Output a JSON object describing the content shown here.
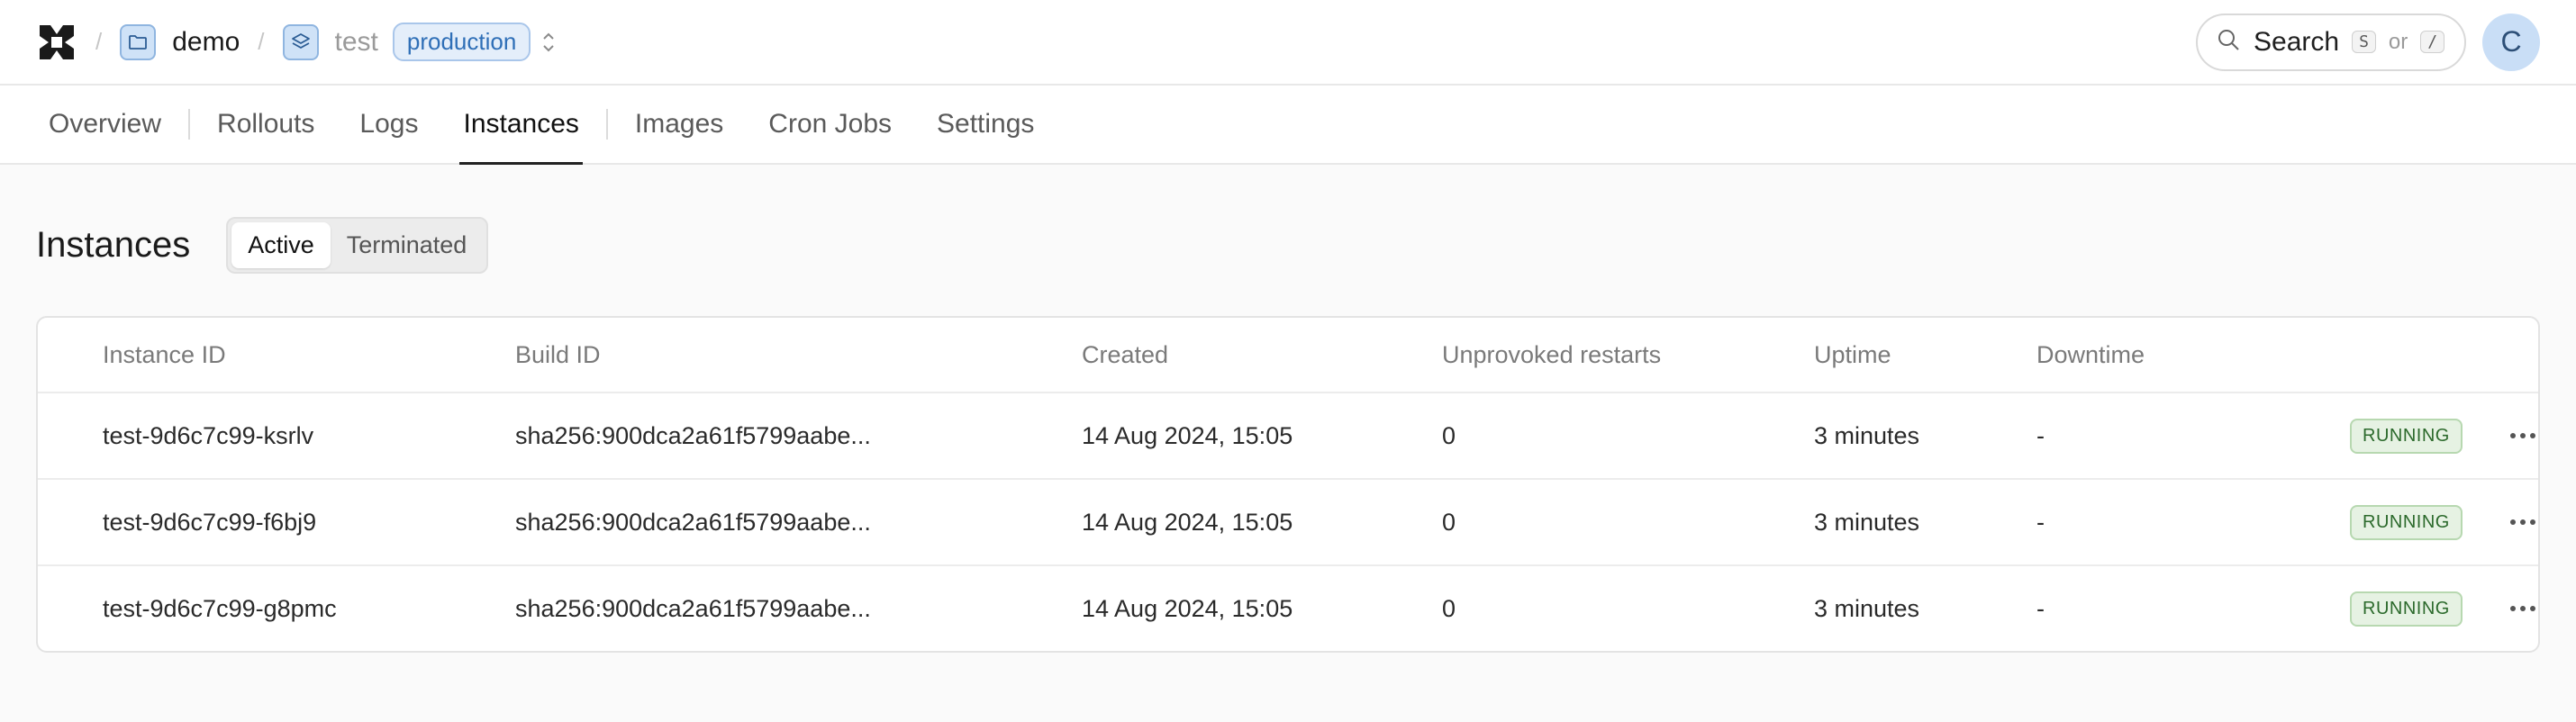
{
  "breadcrumb": {
    "project": "demo",
    "service": "test",
    "environment": "production"
  },
  "search": {
    "label": "Search",
    "shortcut_1": "S",
    "or_label": "or",
    "shortcut_2": "/"
  },
  "user": {
    "initial": "C"
  },
  "tabs": [
    {
      "label": "Overview"
    },
    {
      "label": "Rollouts"
    },
    {
      "label": "Logs"
    },
    {
      "label": "Instances"
    },
    {
      "label": "Images"
    },
    {
      "label": "Cron Jobs"
    },
    {
      "label": "Settings"
    }
  ],
  "page": {
    "title": "Instances",
    "filter_active": "Active",
    "filter_terminated": "Terminated"
  },
  "table": {
    "columns": [
      "Instance ID",
      "Build ID",
      "Created",
      "Unprovoked restarts",
      "Uptime",
      "Downtime"
    ],
    "rows": [
      {
        "instance_id": "test-9d6c7c99-ksrlv",
        "build_id": "sha256:900dca2a61f5799aabe...",
        "created": "14 Aug 2024, 15:05",
        "restarts": "0",
        "uptime": "3 minutes",
        "downtime": "-",
        "status": "RUNNING"
      },
      {
        "instance_id": "test-9d6c7c99-f6bj9",
        "build_id": "sha256:900dca2a61f5799aabe...",
        "created": "14 Aug 2024, 15:05",
        "restarts": "0",
        "uptime": "3 minutes",
        "downtime": "-",
        "status": "RUNNING"
      },
      {
        "instance_id": "test-9d6c7c99-g8pmc",
        "build_id": "sha256:900dca2a61f5799aabe...",
        "created": "14 Aug 2024, 15:05",
        "restarts": "0",
        "uptime": "3 minutes",
        "downtime": "-",
        "status": "RUNNING"
      }
    ]
  },
  "colors": {
    "accent_blue": "#2f6fb7",
    "running_green": "#2c6a2c"
  }
}
